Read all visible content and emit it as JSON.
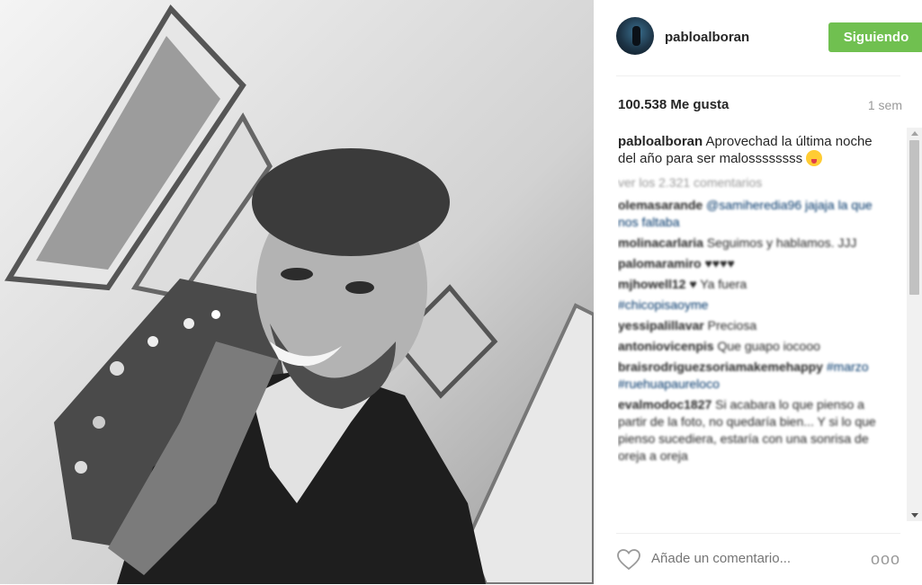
{
  "post": {
    "image_alt": "Black-and-white selfie of a bearded man in a suit biting his tie in front of a Christmas tree"
  },
  "header": {
    "username": "pabloalboran",
    "follow_label": "Siguiendo"
  },
  "stats": {
    "likes": "100.538 Me gusta",
    "time": "1 sem"
  },
  "caption": {
    "username": "pabloalboran",
    "text": " Aprovechad la última noche del año para ser malossssssss "
  },
  "comments": {
    "view_all": "ver los 2.321 comentarios",
    "items": [
      {
        "user": "olemasarande",
        "text": " @samiheredia96 jajaja la que nos faltaba"
      },
      {
        "user": "molinacarlaria",
        "text": " Seguimos y hablamos. JJJ"
      },
      {
        "user": "palomaramiro",
        "text": " ♥♥♥♥"
      },
      {
        "user": "mjhowell12",
        "text": " ♥ Ya fuera"
      },
      {
        "user": "",
        "text": "#chicopisaoyme"
      },
      {
        "user": "yessipalillavar",
        "text": " Preciosa"
      },
      {
        "user": "antoniovicenpis",
        "text": " Que guapo iocooo"
      },
      {
        "user": "braisrodriguezsoriamakemehappy",
        "text": " #marzo #ruehuapaureloco"
      },
      {
        "user": "evalmodoc1827",
        "text": " Si acabara lo que pienso a partir de la foto, no quedaría bien... Y si lo que pienso sucediera, estaría con una sonrisa de oreja a oreja"
      }
    ]
  },
  "footer": {
    "placeholder": "Añade un comentario...",
    "more_label": "ooo"
  },
  "colors": {
    "follow_green": "#70c050",
    "muted_text": "#999999",
    "divider": "#efefef"
  }
}
